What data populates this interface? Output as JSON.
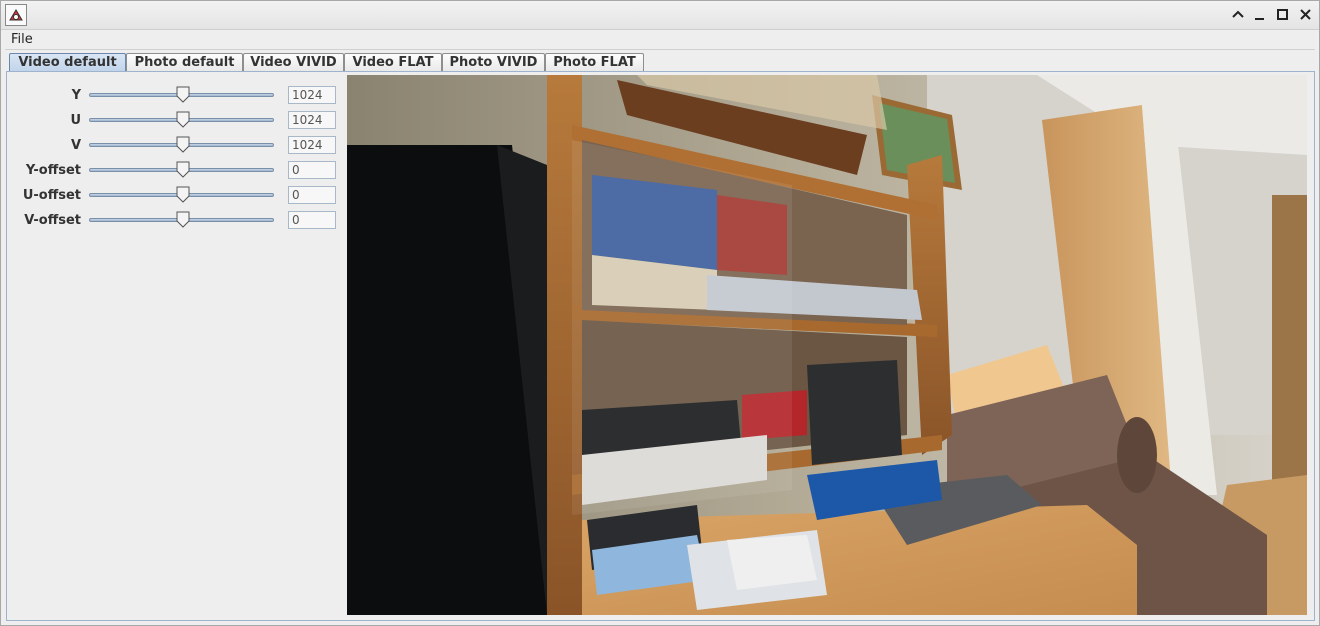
{
  "menu": {
    "file": "File"
  },
  "tabs": [
    {
      "label": "Video default",
      "active": true
    },
    {
      "label": "Photo default",
      "active": false
    },
    {
      "label": "Video VIVID",
      "active": false
    },
    {
      "label": "Video FLAT",
      "active": false
    },
    {
      "label": "Photo VIVID",
      "active": false
    },
    {
      "label": "Photo FLAT",
      "active": false
    }
  ],
  "controls": [
    {
      "label": "Y",
      "value": "1024",
      "level": 0.5
    },
    {
      "label": "U",
      "value": "1024",
      "level": 0.5
    },
    {
      "label": "V",
      "value": "1024",
      "level": 0.5
    },
    {
      "label": "Y-offset",
      "value": "0",
      "level": 0.5
    },
    {
      "label": "U-offset",
      "value": "0",
      "level": 0.5
    },
    {
      "label": "V-offset",
      "value": "0",
      "level": 0.5
    }
  ],
  "icons": {
    "app": "java-app-icon",
    "minimize": "minimize-icon",
    "maximize": "maximize-icon",
    "restore": "collapse-up-icon",
    "close": "close-icon"
  },
  "colors": {
    "active_tab": "#c0d3ea",
    "slider_track": "#9fb4cf",
    "panel_border": "#9fb3cc"
  }
}
